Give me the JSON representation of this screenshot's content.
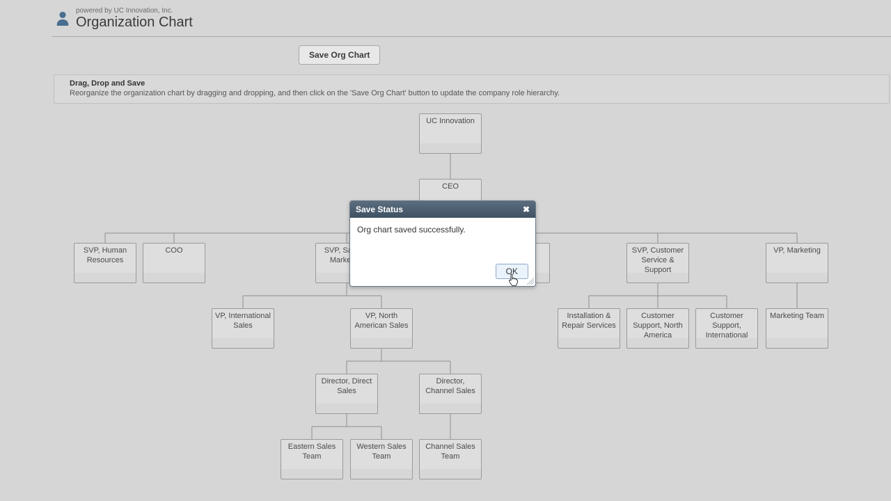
{
  "header": {
    "powered": "powered by UC Innovation, Inc.",
    "title": "Organization Chart"
  },
  "toolbar": {
    "save_label": "Save Org Chart"
  },
  "hint": {
    "title": "Drag, Drop and Save",
    "body": "Reorganize the organization chart by dragging and dropping, and then click on the 'Save Org Chart' button to update the company role hierarchy."
  },
  "dialog": {
    "title": "Save Status",
    "message": "Org chart saved successfully.",
    "ok": "OK"
  },
  "nodes": {
    "root": "UC Innovation",
    "ceo": "CEO",
    "svp_hr": "SVP, Human Resources",
    "coo": "COO",
    "svp_sm": "SVP, Sales & Marketing",
    "svp_css": "SVP, Customer Service & Support",
    "vp_mkt": "VP, Marketing",
    "vp_intl": "VP, International Sales",
    "vp_nam": "VP, North American Sales",
    "irs": "Installation & Repair Services",
    "csna": "Customer Support, North America",
    "csi": "Customer Support, International",
    "mteam": "Marketing Team",
    "dir_direct": "Director, Direct Sales",
    "dir_channel": "Director, Channel Sales",
    "east": "Eastern Sales Team",
    "west": "Western Sales Team",
    "channel_team": "Channel Sales Team"
  }
}
